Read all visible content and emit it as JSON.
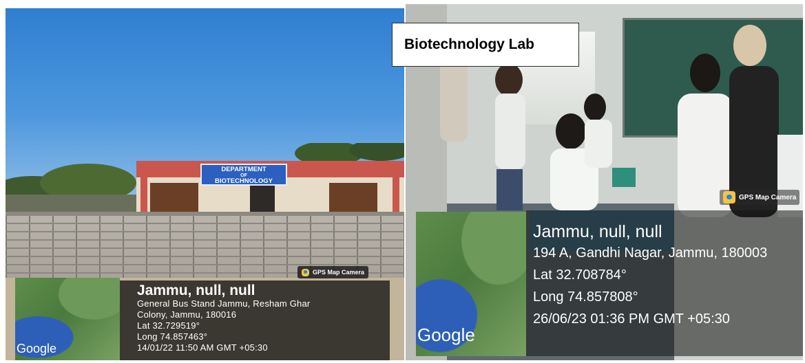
{
  "left_photo": {
    "sign": {
      "line1": "DEPARTMENT",
      "line2": "OF",
      "line3": "BIOTECHNOLOGY"
    },
    "gps_badge": "GPS Map Camera",
    "map_brand": "Google",
    "location": {
      "title": "Jammu, null, null",
      "address_line1": "General Bus Stand Jammu, Resham Ghar",
      "address_line2": "Colony, Jammu, 180016",
      "lat": "Lat 32.729519°",
      "long": "Long 74.857463°",
      "timestamp": "14/01/22 11:50 AM GMT +05:30"
    }
  },
  "right_photo": {
    "caption": "Biotechnology Lab",
    "gps_badge": "GPS Map Camera",
    "map_brand": "Google",
    "location": {
      "title": "Jammu, null, null",
      "address": "194 A, Gandhi Nagar, Jammu, 180003",
      "lat": "Lat 32.708784°",
      "long": "Long 74.857808°",
      "timestamp": "26/06/23 01:36 PM GMT +05:30"
    }
  },
  "colors": {
    "sky": "#4d97de",
    "sign_blue": "#2c5fbf",
    "overlay": "#141414",
    "badge_icon": "#f6c343"
  }
}
